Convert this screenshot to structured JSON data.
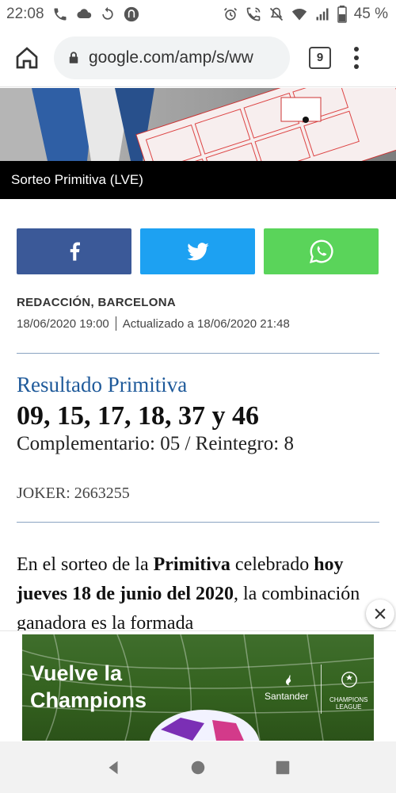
{
  "status_bar": {
    "time": "22:08",
    "battery": "45 %",
    "icons": [
      "phone-icon",
      "cloud-icon",
      "sync-icon",
      "app-badge-icon",
      "alarm-icon",
      "wifi-calling-icon",
      "mute-icon",
      "wifi-icon",
      "signal-icon",
      "battery-icon"
    ]
  },
  "browser": {
    "url": "google.com/amp/s/ww",
    "tab_count": "9"
  },
  "article": {
    "image_caption": "Sorteo Primitiva (LVE)",
    "share": {
      "facebook": "facebook-icon",
      "twitter": "twitter-icon",
      "whatsapp": "whatsapp-icon"
    },
    "byline": "REDACCIÓN, BARCELONA",
    "published": "18/06/2020 19:00",
    "updated": "Actualizado a 18/06/2020 21:48",
    "result_title": "Resultado Primitiva",
    "result_numbers": "09, 15, 17, 18, 37 y 46",
    "complementary": "Complementario: 05 / Reintegro: 8",
    "joker": "JOKER: 2663255",
    "body": {
      "part1": "En el sorteo de la ",
      "bold1": "Primitiva",
      "part2": " celebrado ",
      "bold2": "hoy jueves 18 de junio del 2020",
      "part3": ", la combinación ganadora es la formada"
    }
  },
  "ad": {
    "headline_line1": "Vuelve la",
    "headline_line2": "Champions",
    "brand": "Santander",
    "league_line1": "CHAMPIONS",
    "league_line2": "LEAGUE"
  },
  "colors": {
    "facebook": "#3b5998",
    "twitter": "#1da1f2",
    "whatsapp": "#5ad45a",
    "result_title": "#1f5a9a"
  }
}
